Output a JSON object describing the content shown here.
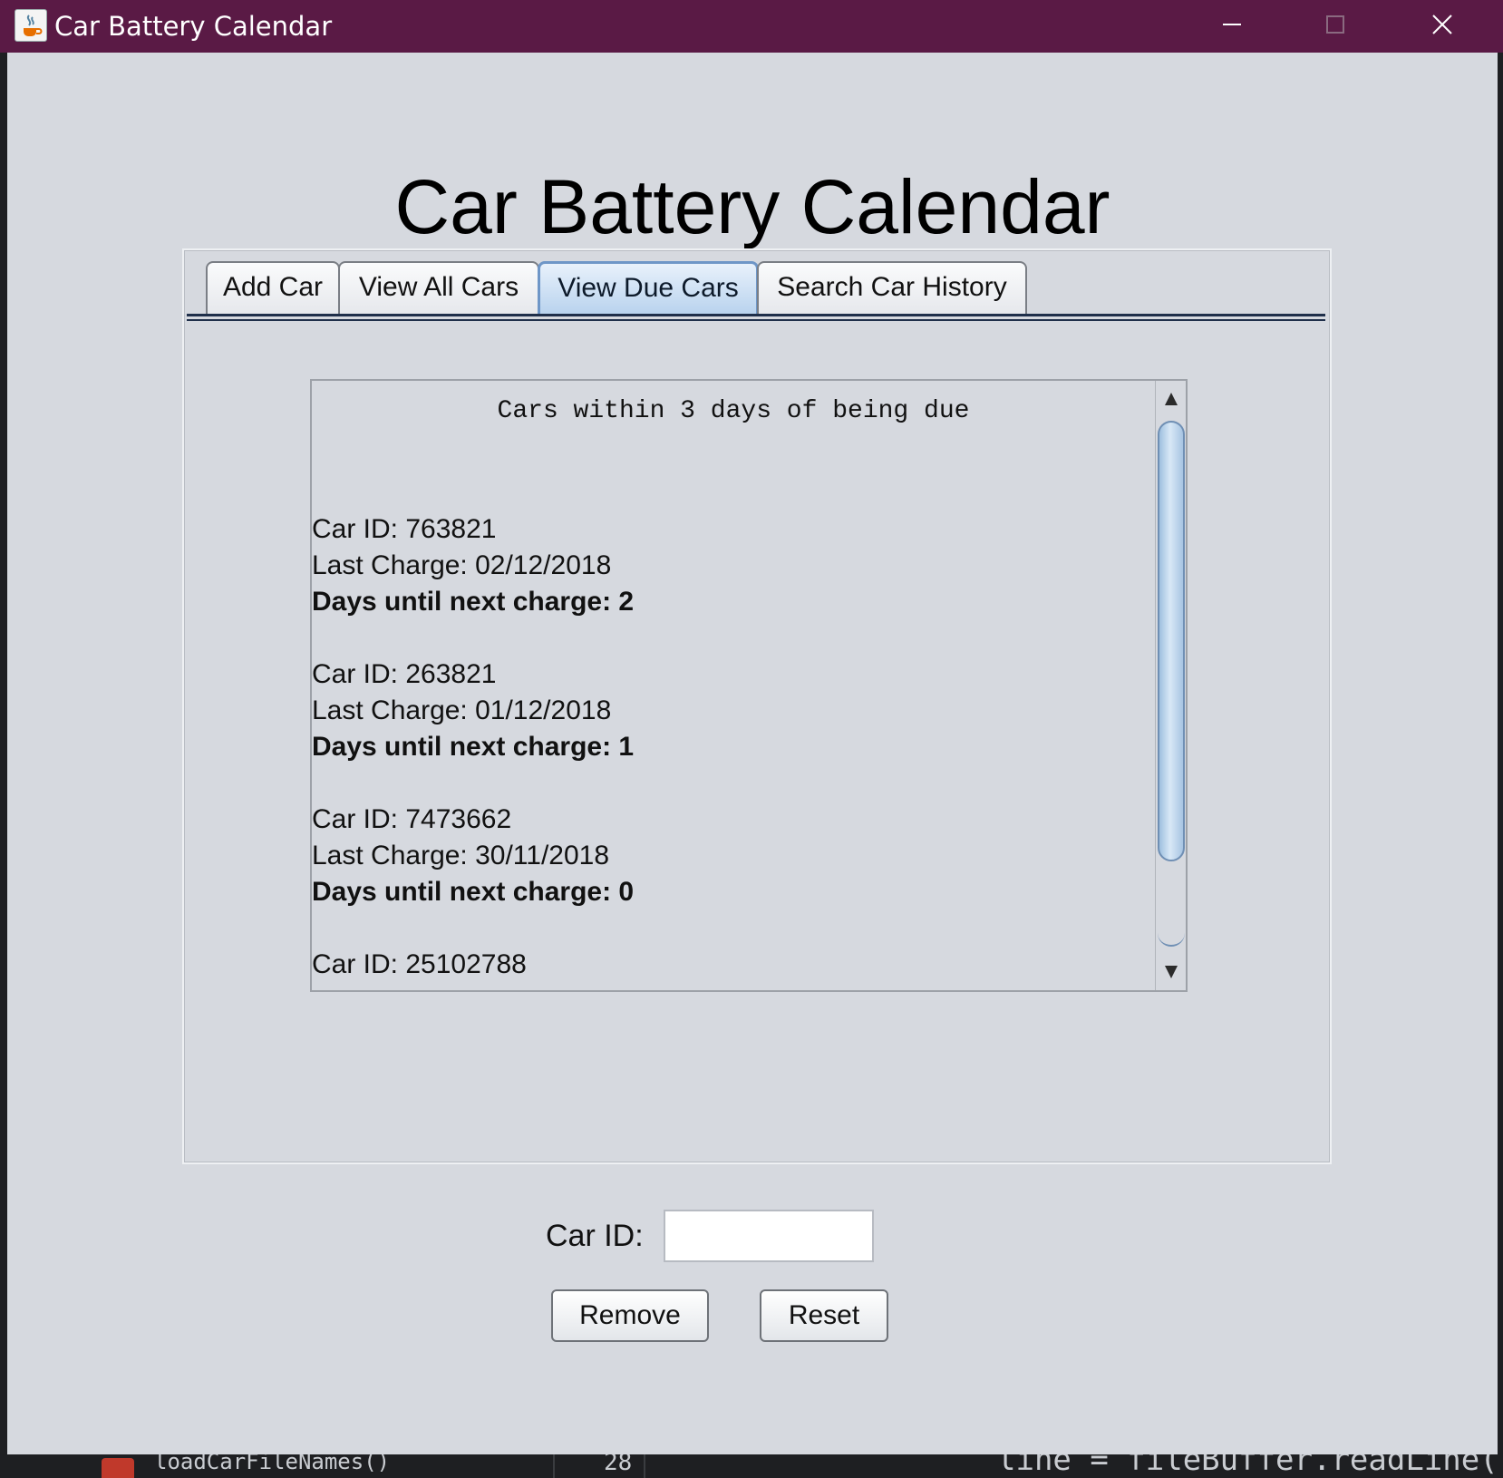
{
  "window": {
    "title": "Car Battery Calendar",
    "icon": "java-cup-icon"
  },
  "page": {
    "title": "Car Battery Calendar"
  },
  "tabs": [
    {
      "label": "Add Car",
      "active": false
    },
    {
      "label": "View All Cars",
      "active": false
    },
    {
      "label": "View Due Cars",
      "active": true
    },
    {
      "label": "Search Car History",
      "active": false
    }
  ],
  "due_list": {
    "heading": "Cars within 3 days of being due",
    "entries": [
      {
        "car_id": "Car ID: 763821",
        "last_charge": "Last Charge: 02/12/2018",
        "days_until": "Days until next charge: 2"
      },
      {
        "car_id": "Car ID: 263821",
        "last_charge": "Last Charge: 01/12/2018",
        "days_until": "Days until next charge: 1"
      },
      {
        "car_id": "Car ID: 7473662",
        "last_charge": "Last Charge: 30/11/2018",
        "days_until": "Days until next charge: 0"
      },
      {
        "car_id": "Car ID: 25102788"
      }
    ]
  },
  "form": {
    "car_id_label": "Car ID:",
    "car_id_value": "",
    "remove_label": "Remove",
    "reset_label": "Reset"
  },
  "background_ide": {
    "left_text": "loadCarFileNames()",
    "line_number": "28",
    "code_text": "line = fileBuffer.readLine()"
  },
  "colors": {
    "titlebar": "#5a1a45",
    "window_bg": "#d6d9df",
    "active_tab": "#b9d3ee",
    "scroll_thumb": "#a7c4e2"
  }
}
